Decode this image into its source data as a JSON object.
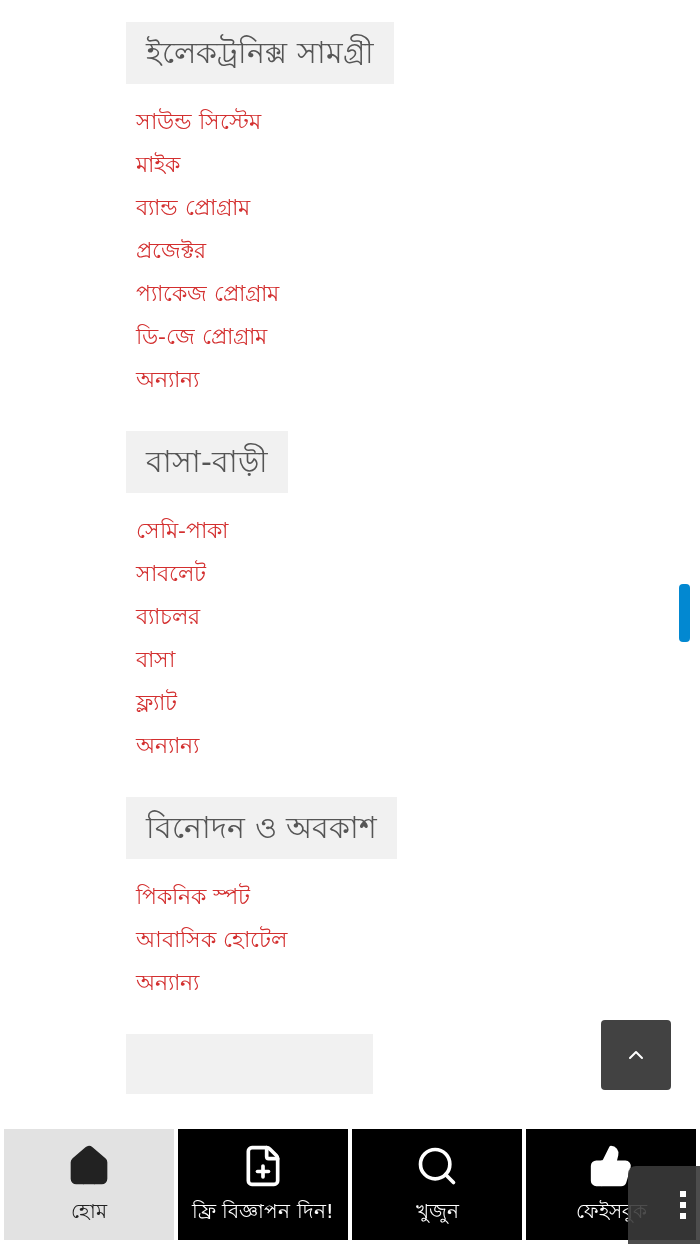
{
  "sections": [
    {
      "title": "ইলেকট্রনিক্স সামগ্রী",
      "links": [
        "সাউন্ড সিস্টেম",
        "মাইক",
        "ব্যান্ড প্রোগ্রাম",
        "প্রজেক্টর",
        "প্যাকেজ প্রোগ্রাম",
        "ডি-জে প্রোগ্রাম",
        "অন্যান্য"
      ]
    },
    {
      "title": "বাসা-বাড়ী",
      "links": [
        "সেমি-পাকা",
        "সাবলেট",
        "ব্যাচলর",
        "বাসা",
        "ফ্ল্যাট",
        "অন্যান্য"
      ]
    },
    {
      "title": "বিনোদন ও অবকাশ",
      "links": [
        "পিকনিক স্পট",
        "আবাসিক হোটেল",
        "অন্যান্য"
      ]
    }
  ],
  "bottom_nav": [
    {
      "label": "হোম",
      "kind": "home",
      "selected": true
    },
    {
      "label": "ফ্রি বিজ্ঞাপন দিন!",
      "kind": "add",
      "selected": false
    },
    {
      "label": "খুজুন",
      "kind": "search",
      "selected": false
    },
    {
      "label": "ফেইসবুক",
      "kind": "like",
      "selected": false
    }
  ]
}
